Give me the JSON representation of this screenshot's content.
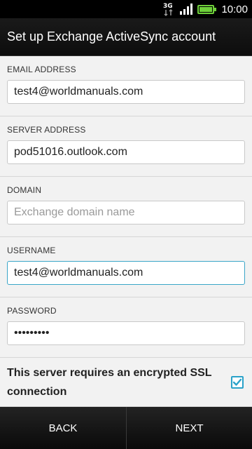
{
  "status_bar": {
    "network_type": "3G",
    "time": "10:00"
  },
  "header": {
    "title": "Set up Exchange ActiveSync account"
  },
  "form": {
    "email": {
      "label": "EMAIL ADDRESS",
      "value": "test4@worldmanuals.com",
      "placeholder": ""
    },
    "server": {
      "label": "SERVER ADDRESS",
      "value": "pod51016.outlook.com",
      "placeholder": ""
    },
    "domain": {
      "label": "DOMAIN",
      "value": "",
      "placeholder": "Exchange domain name"
    },
    "username": {
      "label": "USERNAME",
      "value": "test4@worldmanuals.com",
      "placeholder": ""
    },
    "password": {
      "label": "PASSWORD",
      "value": "•••••••••",
      "placeholder": ""
    },
    "ssl": {
      "label": "This server requires an encrypted SSL connection",
      "checked": true
    }
  },
  "footer": {
    "back_label": "BACK",
    "next_label": "NEXT"
  },
  "colors": {
    "accent": "#2aa2c9",
    "battery": "#6ecf3a"
  }
}
